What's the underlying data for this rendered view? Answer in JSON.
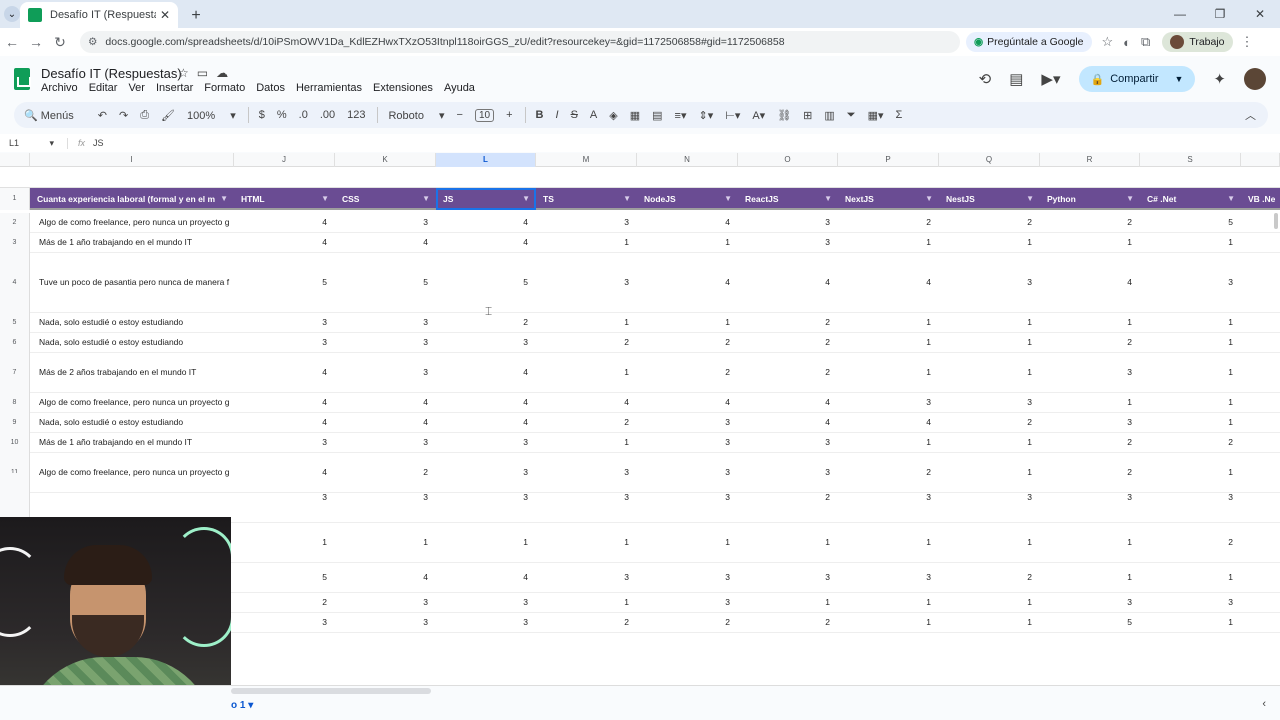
{
  "browser": {
    "tab_title": "Desafío IT (Respuestas) - Hojas",
    "tab_close": "✕",
    "new_tab": "+",
    "url": "docs.google.com/spreadsheets/d/10iPSmOWV1Da_KdlEZHwxTXzO53Itnpl118oirGGS_zU/edit?resourcekey=&gid=1172506858#gid=1172506858",
    "google_button": "Pregúntale a Google",
    "profile": "Trabajo"
  },
  "sheet": {
    "title": "Desafío IT (Respuestas)",
    "menu": [
      "Archivo",
      "Editar",
      "Ver",
      "Insertar",
      "Formato",
      "Datos",
      "Herramientas",
      "Extensiones",
      "Ayuda"
    ],
    "share_label": "Compartir",
    "toolbar": {
      "search": "Menús",
      "zoom": "100%",
      "currency": "$",
      "percent": "%",
      "dec_less": ".0",
      "dec_more": ".00",
      "format_123": "123",
      "font": "Roboto",
      "font_size": "10"
    },
    "name_box": "L1",
    "formula": "JS",
    "sheet_tab": "o 1"
  },
  "columns": [
    {
      "letter": "I",
      "header": "Cuanta experiencia laboral (formal y en el m"
    },
    {
      "letter": "J",
      "header": "HTML"
    },
    {
      "letter": "K",
      "header": "CSS"
    },
    {
      "letter": "L",
      "header": "JS"
    },
    {
      "letter": "M",
      "header": "TS"
    },
    {
      "letter": "N",
      "header": "NodeJS"
    },
    {
      "letter": "O",
      "header": "ReactJS"
    },
    {
      "letter": "P",
      "header": "NextJS"
    },
    {
      "letter": "Q",
      "header": "NestJS"
    },
    {
      "letter": "R",
      "header": "Python"
    },
    {
      "letter": "S",
      "header": "C# .Net"
    },
    {
      "letter": "",
      "header": "VB .Ne"
    }
  ],
  "rows": [
    {
      "n": "2",
      "exp": "Algo de como freelance, pero nunca un proyecto g",
      "v": [
        "4",
        "3",
        "4",
        "3",
        "4",
        "3",
        "2",
        "2",
        "2",
        "5"
      ]
    },
    {
      "n": "3",
      "exp": "Más de 1 año trabajando en el mundo IT",
      "v": [
        "4",
        "4",
        "4",
        "1",
        "1",
        "3",
        "1",
        "1",
        "1",
        "1"
      ]
    },
    {
      "n": "4",
      "exp": "Tuve un poco de pasantia pero nunca de manera f",
      "v": [
        "5",
        "5",
        "5",
        "3",
        "4",
        "4",
        "4",
        "3",
        "4",
        "3"
      ]
    },
    {
      "n": "5",
      "exp": "Nada, solo estudié o estoy estudiando",
      "v": [
        "3",
        "3",
        "2",
        "1",
        "1",
        "2",
        "1",
        "1",
        "1",
        "1"
      ]
    },
    {
      "n": "6",
      "exp": "Nada, solo estudié o estoy estudiando",
      "v": [
        "3",
        "3",
        "3",
        "2",
        "2",
        "2",
        "1",
        "1",
        "2",
        "1"
      ]
    },
    {
      "n": "7",
      "exp": "Más de 2 años trabajando en el mundo IT",
      "v": [
        "4",
        "3",
        "4",
        "1",
        "2",
        "2",
        "1",
        "1",
        "3",
        "1"
      ]
    },
    {
      "n": "8",
      "exp": "Algo de como freelance, pero nunca un proyecto g",
      "v": [
        "4",
        "4",
        "4",
        "4",
        "4",
        "4",
        "3",
        "3",
        "1",
        "1"
      ]
    },
    {
      "n": "9",
      "exp": "Nada, solo estudié o estoy estudiando",
      "v": [
        "4",
        "4",
        "4",
        "2",
        "3",
        "4",
        "4",
        "2",
        "3",
        "1"
      ]
    },
    {
      "n": "10",
      "exp": "Más de 1 año trabajando en el mundo IT",
      "v": [
        "3",
        "3",
        "3",
        "1",
        "3",
        "3",
        "1",
        "1",
        "2",
        "2"
      ]
    },
    {
      "n": "11",
      "exp": "Algo de como freelance, pero nunca un proyecto g",
      "v": [
        "4",
        "2",
        "3",
        "3",
        "3",
        "3",
        "2",
        "1",
        "2",
        "1"
      ]
    },
    {
      "n": "",
      "exp": "",
      "v": [
        "3",
        "3",
        "3",
        "3",
        "3",
        "2",
        "3",
        "3",
        "3",
        "3"
      ]
    },
    {
      "n": "",
      "exp": "",
      "v": [
        "1",
        "1",
        "1",
        "1",
        "1",
        "1",
        "1",
        "1",
        "1",
        "2"
      ]
    },
    {
      "n": "",
      "exp": "",
      "v": [
        "5",
        "4",
        "4",
        "3",
        "3",
        "3",
        "3",
        "2",
        "1",
        "1"
      ]
    },
    {
      "n": "",
      "exp": "",
      "v": [
        "2",
        "3",
        "3",
        "1",
        "3",
        "1",
        "1",
        "1",
        "3",
        "3"
      ]
    },
    {
      "n": "",
      "exp": "",
      "v": [
        "3",
        "3",
        "3",
        "2",
        "2",
        "2",
        "1",
        "1",
        "5",
        "1"
      ]
    }
  ]
}
